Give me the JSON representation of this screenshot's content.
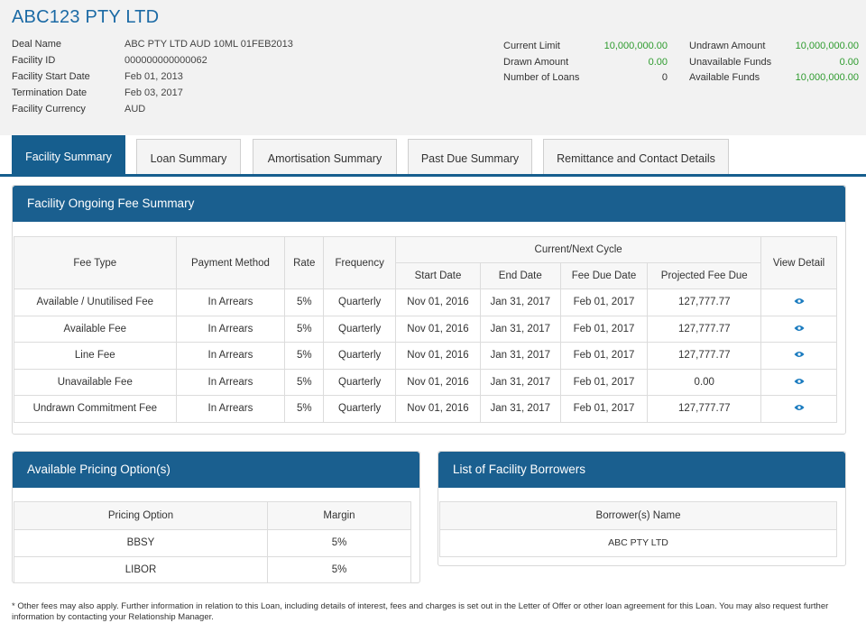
{
  "company": {
    "name": "ABC123 PTY LTD"
  },
  "deal": [
    {
      "label": "Deal Name",
      "value": "ABC PTY LTD AUD 10ML 01FEB2013"
    },
    {
      "label": "Facility ID",
      "value": "000000000000062"
    },
    {
      "label": "Facility Start Date",
      "value": "Feb 01, 2013"
    },
    {
      "label": "Termination Date",
      "value": "Feb 03, 2017"
    },
    {
      "label": "Facility Currency",
      "value": "AUD"
    }
  ],
  "metrics_left": [
    {
      "label": "Current Limit",
      "value": "10,000,000.00"
    },
    {
      "label": "Drawn Amount",
      "value": "0.00"
    },
    {
      "label": "Number of Loans",
      "value": "0"
    }
  ],
  "metrics_right": [
    {
      "label": "Undrawn Amount",
      "value": "10,000,000.00"
    },
    {
      "label": "Unavailable Funds",
      "value": "0.00"
    },
    {
      "label": "Available Funds",
      "value": "10,000,000.00"
    }
  ],
  "tabs": [
    "Facility Summary",
    "Loan Summary",
    "Amortisation Summary",
    "Past Due Summary",
    "Remittance and Contact Details"
  ],
  "fee_panel": {
    "title": "Facility Ongoing Fee Summary",
    "headers": {
      "fee_type": "Fee Type",
      "payment_method": "Payment Method",
      "rate": "Rate",
      "frequency": "Frequency",
      "cycle": "Current/Next Cycle",
      "start_date": "Start Date",
      "end_date": "End Date",
      "fee_due_date": "Fee Due Date",
      "projected_fee_due": "Projected Fee Due",
      "view_detail": "View Detail"
    },
    "rows": [
      {
        "fee_type": "Available / Unutilised Fee",
        "payment_method": "In Arrears",
        "rate": "5%",
        "frequency": "Quarterly",
        "start_date": "Nov 01, 2016",
        "end_date": "Jan 31, 2017",
        "fee_due_date": "Feb 01, 2017",
        "projected_fee_due": "127,777.77"
      },
      {
        "fee_type": "Available Fee",
        "payment_method": "In Arrears",
        "rate": "5%",
        "frequency": "Quarterly",
        "start_date": "Nov 01, 2016",
        "end_date": "Jan 31, 2017",
        "fee_due_date": "Feb 01, 2017",
        "projected_fee_due": "127,777.77"
      },
      {
        "fee_type": "Line Fee",
        "payment_method": "In Arrears",
        "rate": "5%",
        "frequency": "Quarterly",
        "start_date": "Nov 01, 2016",
        "end_date": "Jan 31, 2017",
        "fee_due_date": "Feb 01, 2017",
        "projected_fee_due": "127,777.77"
      },
      {
        "fee_type": "Unavailable Fee",
        "payment_method": "In Arrears",
        "rate": "5%",
        "frequency": "Quarterly",
        "start_date": "Nov 01, 2016",
        "end_date": "Jan 31, 2017",
        "fee_due_date": "Feb 01, 2017",
        "projected_fee_due": "0.00"
      },
      {
        "fee_type": "Undrawn Commitment Fee",
        "payment_method": "In Arrears",
        "rate": "5%",
        "frequency": "Quarterly",
        "start_date": "Nov 01, 2016",
        "end_date": "Jan 31, 2017",
        "fee_due_date": "Feb 01, 2017",
        "projected_fee_due": "127,777.77"
      }
    ]
  },
  "pricing_panel": {
    "title": "Available Pricing Option(s)",
    "headers": {
      "option": "Pricing Option",
      "margin": "Margin"
    },
    "rows": [
      {
        "option": "BBSY",
        "margin": "5%"
      },
      {
        "option": "LIBOR",
        "margin": "5%"
      }
    ]
  },
  "borrowers_panel": {
    "title": "List of Facility Borrowers",
    "header": "Borrower(s) Name",
    "rows": [
      "ABC PTY LTD"
    ]
  },
  "footnote": "* Other fees may also apply. Further information in relation to this Loan, including details of interest, fees and charges is set out in the Letter of Offer or other loan agreement for this Loan. You may also request further information by contacting your Relationship Manager.",
  "colors": {
    "brand_blue": "#1a5f8f",
    "title_blue": "#1b6aa5",
    "value_green": "#2e9b2e",
    "eye_blue": "#1a7bbf"
  },
  "icons": {
    "view_detail": "eye-icon"
  }
}
